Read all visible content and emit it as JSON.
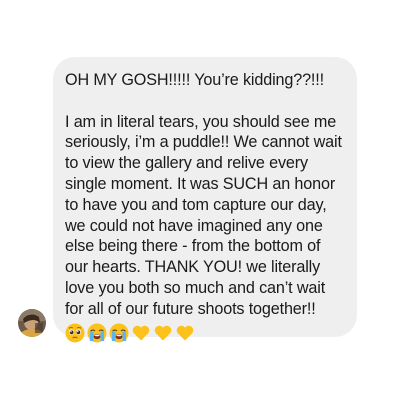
{
  "conversation": {
    "message": {
      "headline": "OH MY GOSH!!!!! You’re kidding??!!!",
      "body_lines": [
        "I am in literal tears, you should see me",
        "seriously, i’m a puddle!! We cannot wait",
        "to view the gallery and relive every",
        "single moment. It was SUCH an honor",
        "to have you and tom capture our day,",
        "we could not have imagined any one",
        "else being there - from the bottom of",
        "our hearts. THANK YOU! we literally",
        "love you both so much and can’t wait",
        "for all of our future shoots together!!"
      ],
      "emojis": [
        "pleading-face-emoji",
        "loudly-crying-face-emoji",
        "loudly-crying-face-emoji",
        "yellow-heart-emoji",
        "yellow-heart-emoji",
        "yellow-heart-emoji"
      ]
    },
    "sender": {
      "avatar": "profile-photo"
    },
    "colors": {
      "bubble_background": "#efefef",
      "text": "#1a1a1a",
      "background": "#ffffff"
    }
  }
}
